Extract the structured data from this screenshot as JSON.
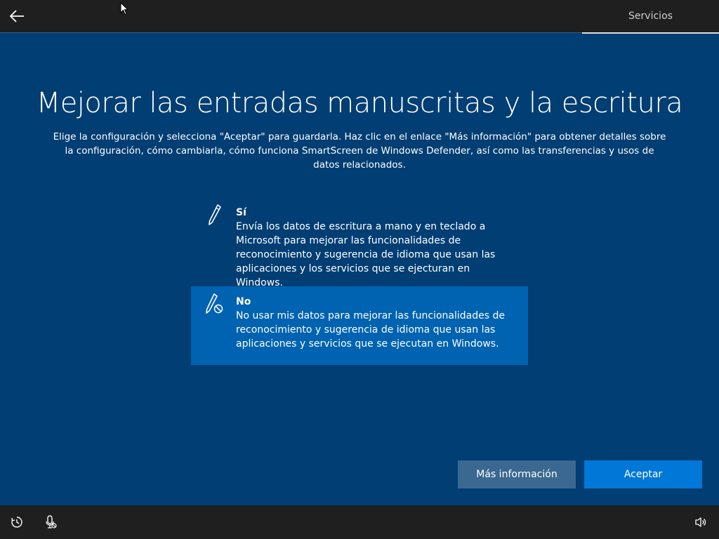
{
  "header": {
    "back_icon": "arrow-left-icon",
    "section_label": "Servicios"
  },
  "main": {
    "title": "Mejorar las entradas manuscritas y la escritura",
    "subtitle": "Elige la configuración y selecciona \"Aceptar\" para guardarla. Haz clic en el enlace \"Más información\" para obtener detalles sobre la configuración, cómo cambiarla, cómo funciona SmartScreen de Windows Defender, así como las transferencias y usos de datos relacionados.",
    "options": [
      {
        "icon": "pen-icon",
        "title": "Sí",
        "description": "Envía los datos de escritura a mano y en teclado a Microsoft para mejorar las funcionalidades de reconocimiento y sugerencia de idioma que usan las aplicaciones y los servicios que se ejecturan en Windows.",
        "selected": false
      },
      {
        "icon": "pen-disabled-icon",
        "title": "No",
        "description": "No usar mis datos para mejorar las funcionalidades de reconocimiento y sugerencia de idioma que usan las aplicaciones y servicios que se ejecutan en Windows.",
        "selected": true
      }
    ]
  },
  "actions": {
    "more_info_label": "Más información",
    "accept_label": "Aceptar"
  },
  "footer": {
    "icons": [
      "ease-of-access-icon",
      "microphone-icon",
      "volume-icon"
    ]
  },
  "colors": {
    "background": "#003e73",
    "selected_option": "#0063b1",
    "accept_button": "#0078d7",
    "secondary_button": "#3b6891",
    "bars": "#1f1f1f"
  }
}
